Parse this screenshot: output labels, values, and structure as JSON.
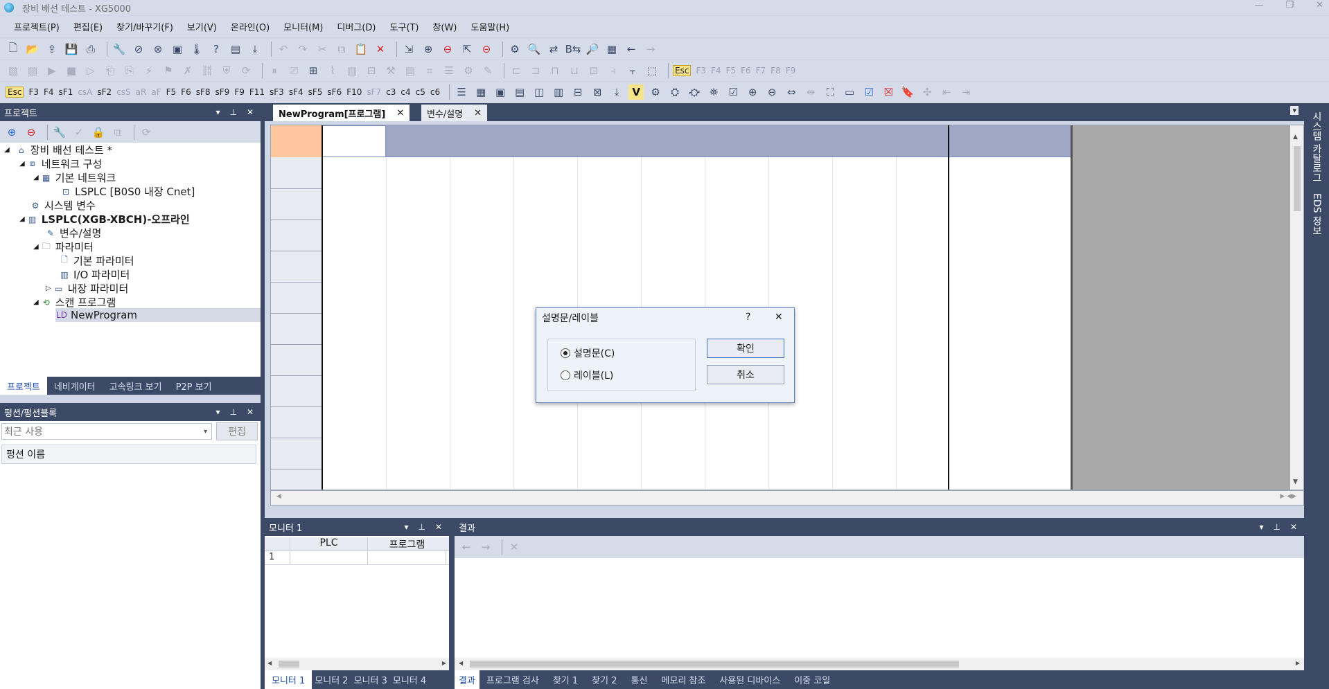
{
  "window": {
    "title": "장비 배선 테스트 - XG5000"
  },
  "menu": [
    "프로젝트(P)",
    "편집(E)",
    "찾기/바꾸기(F)",
    "보기(V)",
    "온라인(O)",
    "모니터(M)",
    "디버그(D)",
    "도구(T)",
    "창(W)",
    "도움말(H)"
  ],
  "fkeys_row2": [
    "Esc",
    "F3",
    "F4",
    "F5",
    "F6",
    "F7",
    "F8",
    "F9"
  ],
  "fkeys_row3": [
    "Esc",
    "F3",
    "F4",
    "sF1",
    "csA",
    "sF2",
    "csS",
    "aR",
    "aF",
    "F5",
    "F6",
    "sF8",
    "sF9",
    "F9",
    "F11",
    "sF3",
    "sF4",
    "sF5",
    "sF6",
    "F10",
    "sF7",
    "c3",
    "c4",
    "c5",
    "c6"
  ],
  "project_panel": {
    "title": "프로젝트",
    "tree": [
      "장비 배선 테스트 *",
      "네트워크 구성",
      "기본 네트워크",
      "LSPLC [B0S0 내장 Cnet]",
      "시스템 변수",
      "LSPLC(XGB-XBCH)-오프라인",
      "변수/설명",
      "파라미터",
      "기본 파라미터",
      "I/O 파라미터",
      "내장 파라미터",
      "스캔 프로그램",
      "NewProgram"
    ],
    "tabs": [
      "프로젝트",
      "네비게이터",
      "고속링크 보기",
      "P2P 보기"
    ]
  },
  "function_panel": {
    "title": "펑션/펑션블록",
    "search_value": "최근 사용",
    "edit_button": "편집",
    "column": "펑션 이름"
  },
  "doc_tabs": [
    "NewProgram[프로그램]",
    "변수/설명"
  ],
  "right_rail": [
    "시스템 카탈로그",
    "EDS 정보"
  ],
  "dialog": {
    "title": "설명문/레이블",
    "help": "?",
    "options": [
      "설명문(C)",
      "레이블(L)"
    ],
    "selected": 0,
    "ok": "확인",
    "cancel": "취소"
  },
  "monitor_panel": {
    "title": "모니터 1",
    "columns": [
      "PLC",
      "프로그램"
    ],
    "row": "1",
    "tabs": [
      "모니터 1",
      "모니터 2",
      "모니터 3",
      "모니터 4"
    ]
  },
  "result_panel": {
    "title": "결과",
    "tabs": [
      "결과",
      "프로그램 검사",
      "찾기 1",
      "찾기 2",
      "통신",
      "메모리 참조",
      "사용된 디바이스",
      "이중 코일"
    ]
  }
}
